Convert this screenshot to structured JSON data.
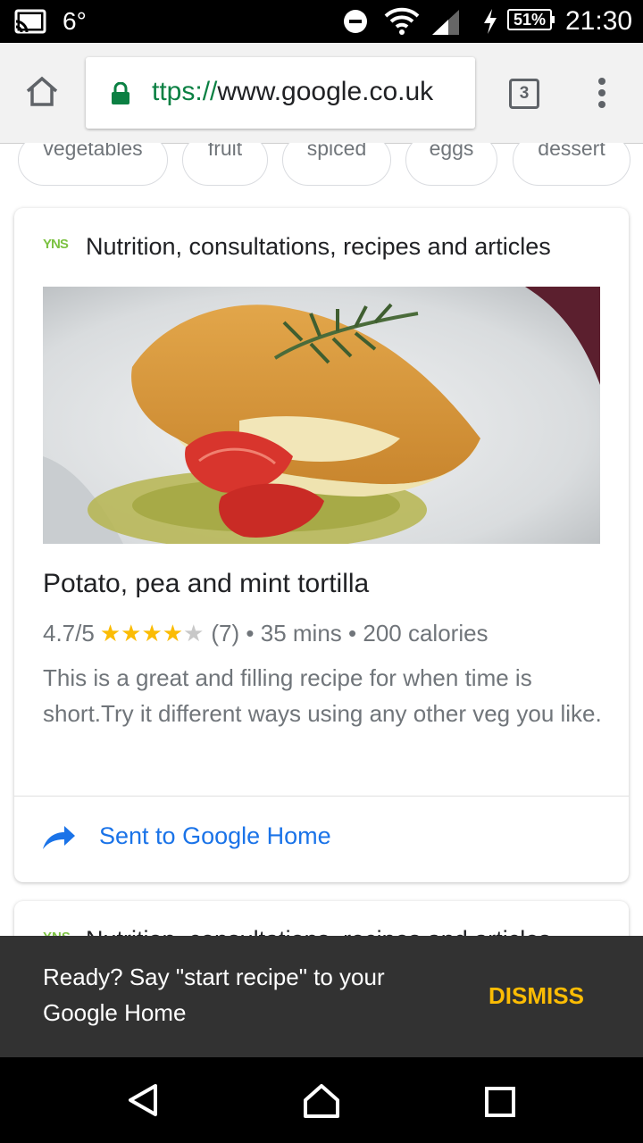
{
  "status_bar": {
    "temperature": "6°",
    "battery": "51%",
    "time": "21:30"
  },
  "browser": {
    "url_scheme": "ttps://",
    "url_host": "www.google.co.uk",
    "tab_count": "3"
  },
  "chips": [
    "vegetables",
    "fruit",
    "spiced",
    "eggs",
    "dessert"
  ],
  "card": {
    "source_logo": "YNS",
    "source": "Nutrition, consultations, recipes and articles",
    "title": "Potato, pea and mint tortilla",
    "rating": "4.7/5",
    "stars": "★★★★",
    "star_half": "★",
    "rating_value": 4.7,
    "review_count": "(7)",
    "sep1": "•",
    "time": "35 mins",
    "sep2": "•",
    "calories": "200 calories",
    "description": "This is a great and filling recipe for when time is short.Try it different ways using any other veg you like.",
    "action_label": "Sent to Google Home"
  },
  "card2": {
    "source_logo": "YNS",
    "source": "Nutrition, consultations, recipes and articles"
  },
  "snackbar": {
    "message": "Ready? Say \"start recipe\" to your Google Home",
    "action": "DISMISS"
  },
  "colors": {
    "accent_link": "#1a73e8",
    "star": "#fbbc04",
    "secure_green": "#0b8043",
    "snackbar_bg": "#323232",
    "snackbar_action": "#fbbc04"
  },
  "icons": {
    "status": [
      "cast-icon",
      "dnd-icon",
      "wifi-icon",
      "signal-icon",
      "charging-icon",
      "battery-icon"
    ],
    "toolbar": [
      "home-icon",
      "lock-icon",
      "tab-switcher-icon",
      "overflow-menu-icon"
    ],
    "card": [
      "share-arrow-icon"
    ],
    "nav": [
      "back-icon",
      "home-nav-icon",
      "recents-icon"
    ]
  }
}
